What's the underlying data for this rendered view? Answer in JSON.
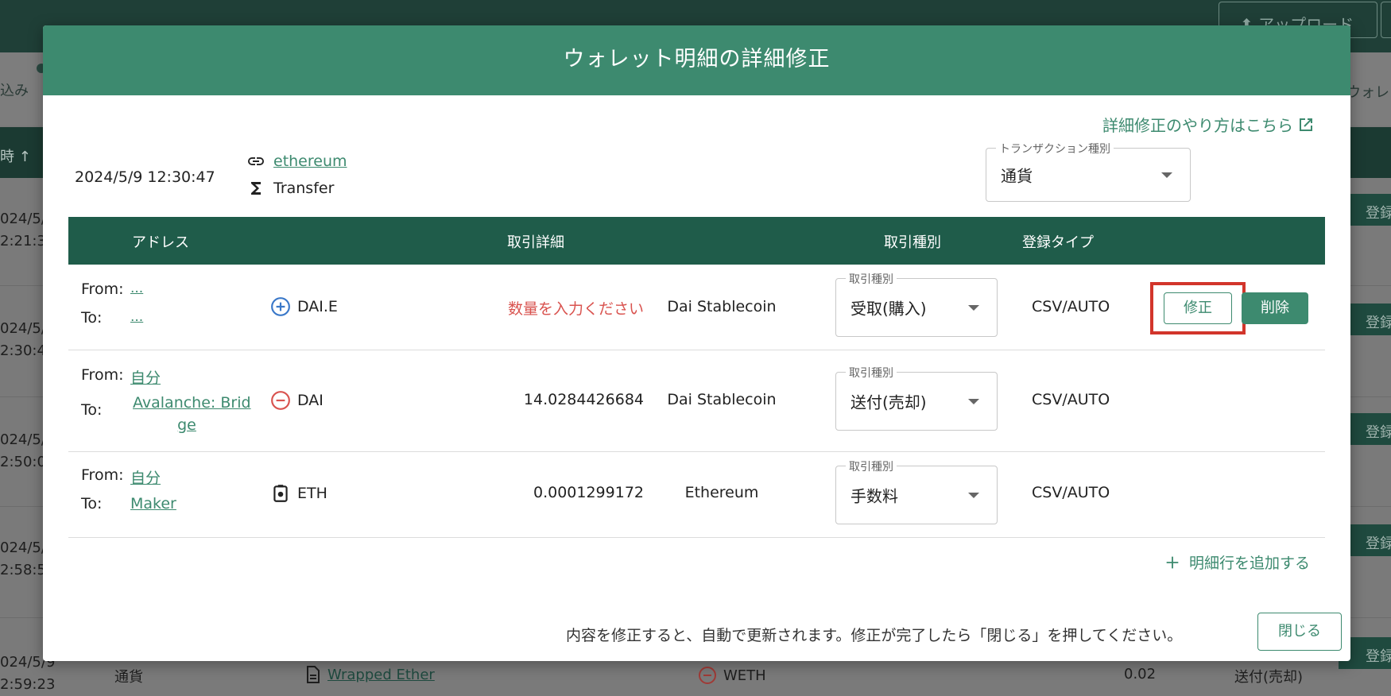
{
  "background": {
    "upload_label": "アップロード",
    "left_partial": "込み",
    "right_partial": "ウォレ",
    "header_partial": "時 ↑",
    "register_partial": "登録",
    "rows": [
      {
        "date": "024/5/\n2:21:3"
      },
      {
        "date": "024/5/\n2:30:4"
      },
      {
        "date": "024/5/\n2:50:0"
      },
      {
        "date": "024/5/\n2:58:5"
      },
      {
        "date": "024/5/9\n2:59:23"
      }
    ],
    "bottom": {
      "type": "通貨",
      "token_link": "Wrapped Ether",
      "asset": "WETH",
      "amount": "0.02",
      "kind": "送付(売却)"
    }
  },
  "modal": {
    "title": "ウォレット明細の詳細修正",
    "help_link": "詳細修正のやり方はこちら",
    "timestamp": "2024/5/9 12:30:47",
    "chain_link": "ethereum",
    "method": "Transfer",
    "tx_type": {
      "legend": "トランザクション種別",
      "value": "通貨"
    },
    "columns": {
      "address": "アドレス",
      "detail": "取引詳細",
      "kind": "取引種別",
      "regtype": "登録タイプ"
    },
    "rows": [
      {
        "from_label": "From:",
        "from": "...",
        "to_label": "To:",
        "to": "...",
        "asset": "DAI.E",
        "amount": "数量を入力ください",
        "name": "Dai Stablecoin",
        "kind_legend": "取引種別",
        "kind": "受取(購入)",
        "regtype": "CSV/AUTO",
        "edit_label": "修正",
        "delete_label": "削除"
      },
      {
        "from_label": "From:",
        "from": "自分",
        "to_label": "To:",
        "to": "Avalanche: Brid",
        "to2": "ge",
        "asset": "DAI",
        "amount": "14.0284426684",
        "name": "Dai Stablecoin",
        "kind_legend": "取引種別",
        "kind": "送付(売却)",
        "regtype": "CSV/AUTO"
      },
      {
        "from_label": "From:",
        "from": "自分",
        "to_label": "To:",
        "to": "Maker",
        "asset": "ETH",
        "amount": "0.0001299172",
        "name": "Ethereum",
        "kind_legend": "取引種別",
        "kind": "手数料",
        "regtype": "CSV/AUTO"
      }
    ],
    "add_row_label": "明細行を追加する",
    "footer_note": "内容を修正すると、自動で更新されます。修正が完了したら「閉じる」を押してください。",
    "close_label": "閉じる"
  },
  "colors": {
    "primary": "#3d8a6f",
    "header_dark": "#1f5c4a",
    "warning": "#d9534f",
    "highlight": "#d2352b"
  }
}
